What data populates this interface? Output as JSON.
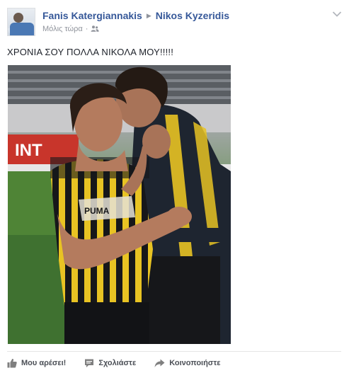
{
  "post": {
    "author": "Fanis Katergiannakis",
    "target": "Nikos Kyzeridis",
    "timestamp": "Μόλις τώρα",
    "audience_icon": "friends-icon",
    "options_icon": "chevron-down-icon",
    "text": "ΧΡΟΝΙΑ ΣΟΥ ΠΟΛΛΑ ΝΙΚΟΛΑ ΜΟΥ!!!!!",
    "photo_alt": "",
    "actions": {
      "like": "Μου αρέσει!",
      "comment": "Σχολιάστε",
      "share": "Κοινοποιήστε"
    }
  },
  "colors": {
    "link": "#365899",
    "meta": "#90949c",
    "action_text": "#4b4f56",
    "jersey_yellow": "#e8c323",
    "jersey_black": "#16171a"
  }
}
